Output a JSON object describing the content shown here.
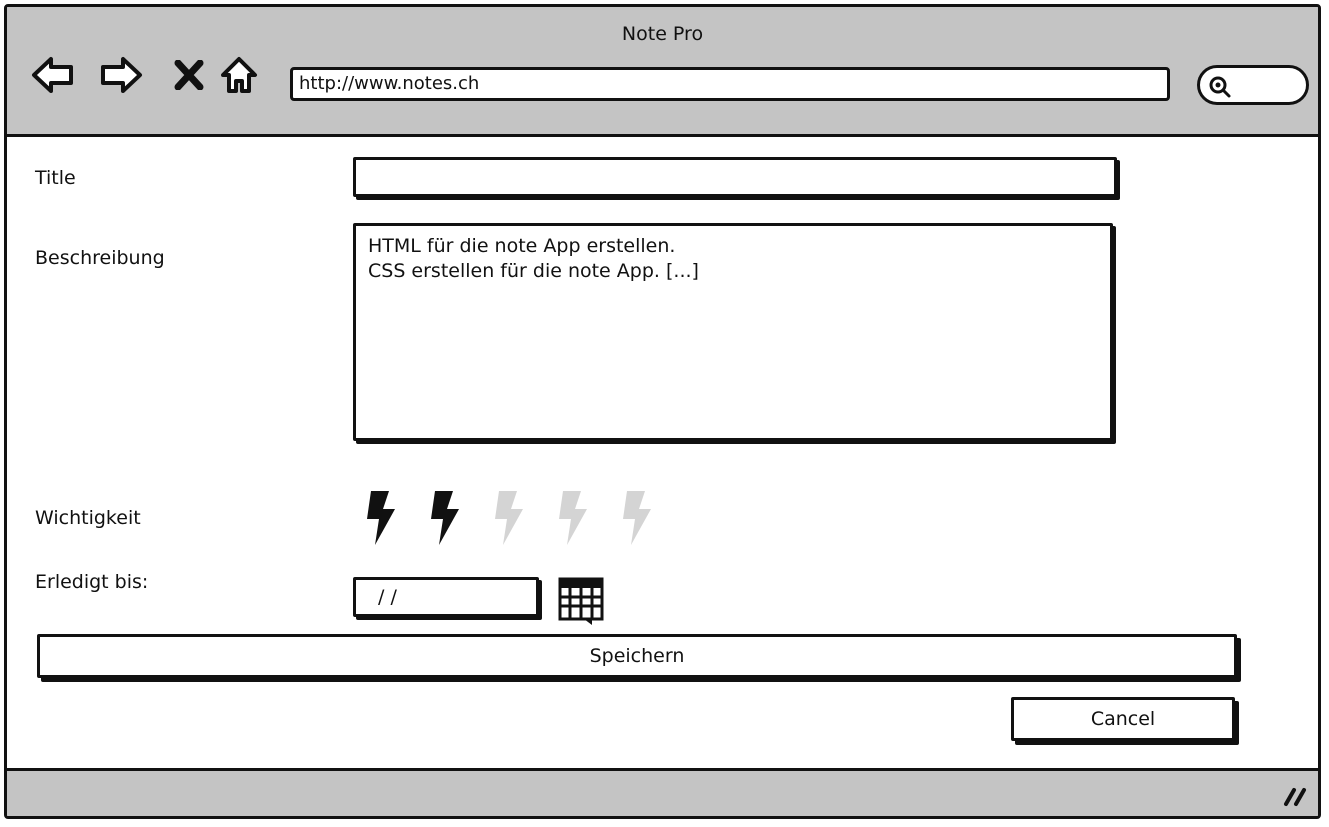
{
  "window": {
    "title": "Note Pro"
  },
  "browser": {
    "url": "http://www.notes.ch",
    "nav_icons": [
      "back-arrow-icon",
      "forward-arrow-icon",
      "stop-icon",
      "home-icon"
    ],
    "search_icon": "search-icon"
  },
  "form": {
    "title_label": "Title",
    "title_value": "",
    "description_label": "Beschreibung",
    "description_value": "HTML für die note App erstellen.\nCSS erstellen für die note App. [...]",
    "importance_label": "Wichtigkeit",
    "importance": {
      "value": 2,
      "max": 5,
      "icon": "lightning-bolt-icon",
      "active_color": "#111111",
      "inactive_color": "#d4d4d4"
    },
    "due_label": "Erledigt bis:",
    "due_value": "/ /",
    "calendar_icon": "calendar-icon",
    "save_label": "Speichern",
    "cancel_label": "Cancel"
  },
  "colors": {
    "chrome": "#c4c4c4",
    "border": "#111111",
    "background": "#ffffff"
  }
}
